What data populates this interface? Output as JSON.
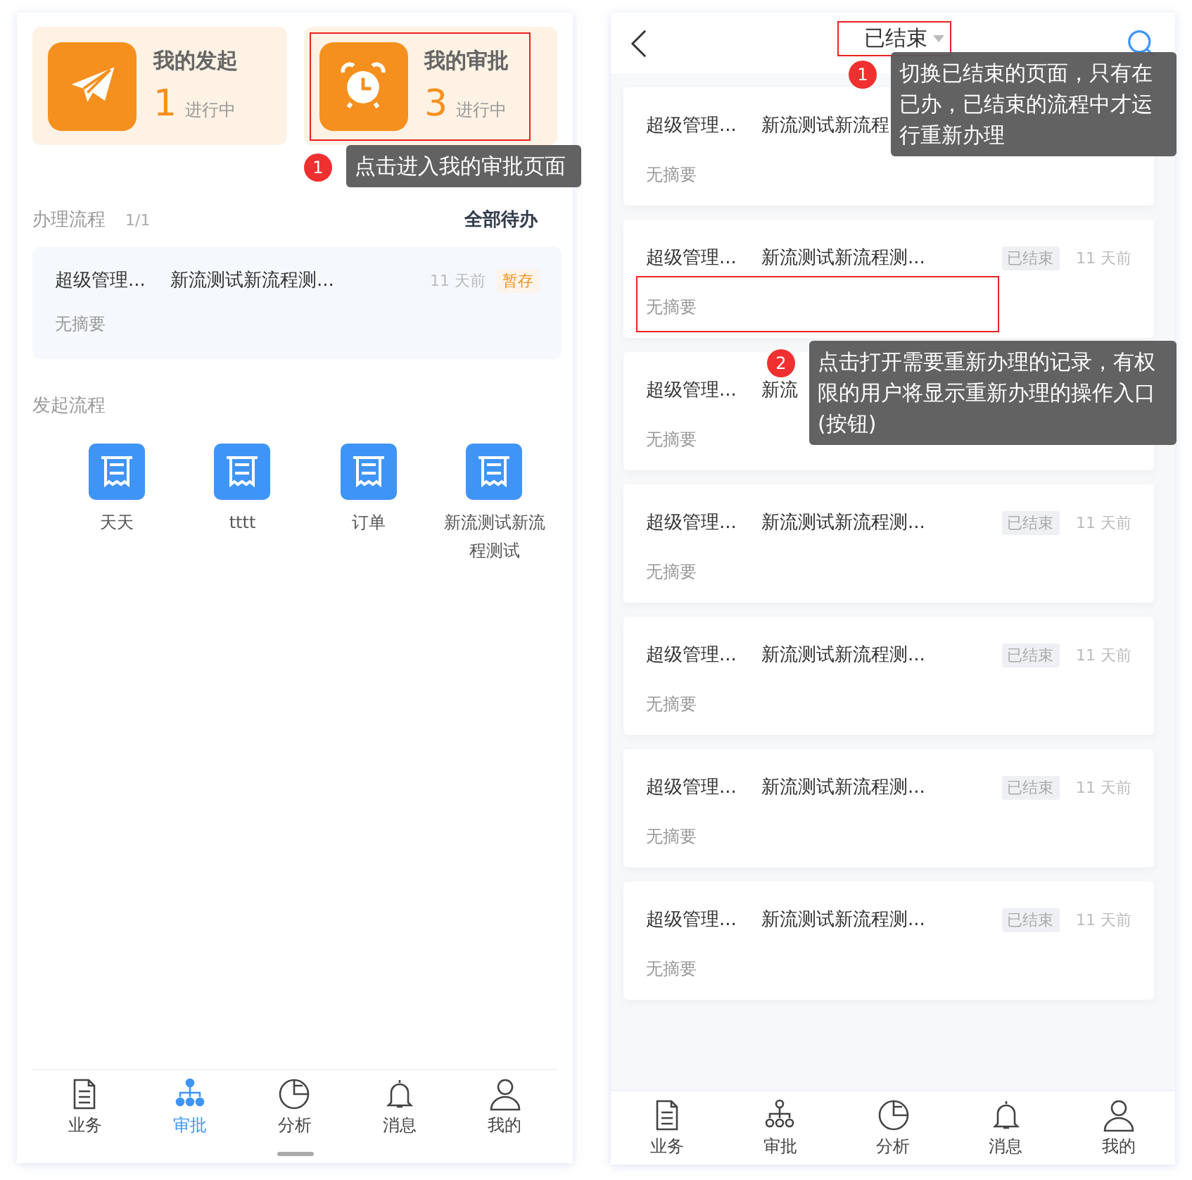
{
  "left_screen": {
    "stat_cards": [
      {
        "kind": "plane",
        "title": "我的发起",
        "count": "1",
        "status": "进行中",
        "highlighted": false
      },
      {
        "kind": "clock",
        "title": "我的审批",
        "count": "3",
        "status": "进行中",
        "highlighted": true
      }
    ],
    "pending_section": {
      "title": "办理流程",
      "count": "1/1",
      "link": "全部待办"
    },
    "pending_tasks": [
      {
        "applicant": "超级管理...",
        "title": "新流测试新流程测...",
        "time": "11 天前",
        "tag": "暂存",
        "summary": "无摘要"
      }
    ],
    "start_section": {
      "title": "发起流程"
    },
    "start_items": [
      {
        "label": "天天"
      },
      {
        "label": "tttt"
      },
      {
        "label": "订单"
      },
      {
        "label": "新流测试新流程测试"
      }
    ],
    "tab_bar": [
      {
        "kind": "doc",
        "label": "业务",
        "selected": false
      },
      {
        "kind": "org",
        "label": "审批",
        "selected": true
      },
      {
        "kind": "pie",
        "label": "分析",
        "selected": false
      },
      {
        "kind": "bell",
        "label": "消息",
        "selected": false
      },
      {
        "kind": "user",
        "label": "我的",
        "selected": false
      }
    ],
    "callout": {
      "number": "1",
      "text": "点击进入我的审批页面"
    }
  },
  "right_screen": {
    "header": {
      "title": "已结束",
      "highlighted": true
    },
    "records": [
      {
        "applicant": "超级管理...",
        "title": "新流测试新流程",
        "summary": "无摘要",
        "highlighted": false
      },
      {
        "applicant": "超级管理...",
        "title": "新流测试新流程测...",
        "tag": "已结束",
        "time": "11 天前",
        "summary": "无摘要",
        "highlighted": true
      },
      {
        "applicant": "超级管理...",
        "title": "新流",
        "summary": "无摘要",
        "highlighted": false
      },
      {
        "applicant": "超级管理...",
        "title": "新流测试新流程测...",
        "tag": "已结束",
        "time": "11 天前",
        "summary": "无摘要",
        "highlighted": false
      },
      {
        "applicant": "超级管理...",
        "title": "新流测试新流程测...",
        "tag": "已结束",
        "time": "11 天前",
        "summary": "无摘要",
        "highlighted": false
      },
      {
        "applicant": "超级管理...",
        "title": "新流测试新流程测...",
        "tag": "已结束",
        "time": "11 天前",
        "summary": "无摘要",
        "highlighted": false
      },
      {
        "applicant": "超级管理...",
        "title": "新流测试新流程测...",
        "tag": "已结束",
        "time": "11 天前",
        "summary": "无摘要",
        "highlighted": false
      }
    ],
    "tab_bar": [
      {
        "kind": "doc",
        "label": "业务",
        "selected": false
      },
      {
        "kind": "org",
        "label": "审批",
        "selected": false
      },
      {
        "kind": "pie",
        "label": "分析",
        "selected": false
      },
      {
        "kind": "bell",
        "label": "消息",
        "selected": false
      },
      {
        "kind": "user",
        "label": "我的",
        "selected": false
      }
    ],
    "callouts": [
      {
        "number": "1",
        "text": "切换已结束的页面，只有在已办，已结束的流程中才运行重新办理"
      },
      {
        "number": "2",
        "text": "点击打开需要重新办理的记录，有权限的用户将显示重新办理的操作入口(按钮)"
      }
    ]
  }
}
